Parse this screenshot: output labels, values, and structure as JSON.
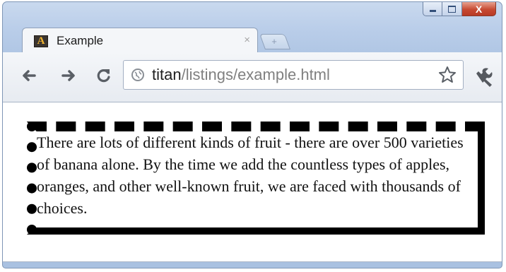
{
  "window": {
    "caption_buttons": {
      "minimize_icon": "minimize-icon",
      "maximize_icon": "maximize-icon",
      "close_glyph": "X"
    }
  },
  "tabs": [
    {
      "title": "Example",
      "favicon_letter": "A",
      "close_glyph": "×",
      "active": true
    }
  ],
  "new_tab": {
    "icon": "plus-icon",
    "glyph": "+"
  },
  "toolbar": {
    "back_icon": "back-arrow-icon",
    "forward_icon": "forward-arrow-icon",
    "reload_icon": "reload-icon",
    "url_host": "titan",
    "url_path": "/listings/example.html",
    "bookmark_icon": "star-icon",
    "menu_icon": "wrench-icon"
  },
  "page": {
    "paragraph": "There are lots of different kinds of fruit - there are over 500 varieties of banana alone. By the time we add the countless types of apples, oranges, and other well-known fruit, we are faced with thousands of choices."
  },
  "colors": {
    "frame": "#b9cde9",
    "close_button": "#c74a32",
    "border": "#000000"
  }
}
